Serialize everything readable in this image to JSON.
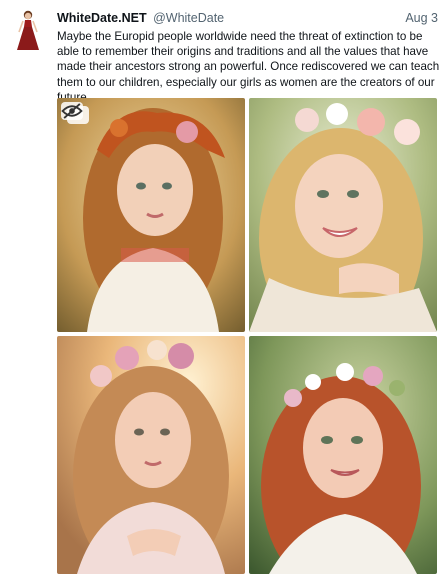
{
  "post": {
    "display_name": "WhiteDate.NET",
    "handle": "@WhiteDate",
    "date": "Aug 3",
    "text": "Maybe the Europid people worldwide need the threat of extinction to be able to remember their origins and traditions and all the values that have made their ancestors strong an powerful. Once rediscovered we can teach them to our children, especially our girls as women are the creators of our future."
  },
  "avatar": {
    "icon": "woman-in-red-dress",
    "color": "#8b1a1a"
  },
  "media": {
    "photos": [
      {
        "icon": "girl-portrait-autumn-leaf-crown",
        "bg": "#c9a062"
      },
      {
        "icon": "girl-portrait-rose-crown-smiling",
        "bg": "#9fb07a"
      },
      {
        "icon": "girl-portrait-flower-crown-sunset",
        "bg": "#e2b37c"
      },
      {
        "icon": "girl-portrait-red-hair-flower-crown",
        "bg": "#7f9a5e"
      }
    ],
    "badge_icon": "eye-slash-icon"
  }
}
